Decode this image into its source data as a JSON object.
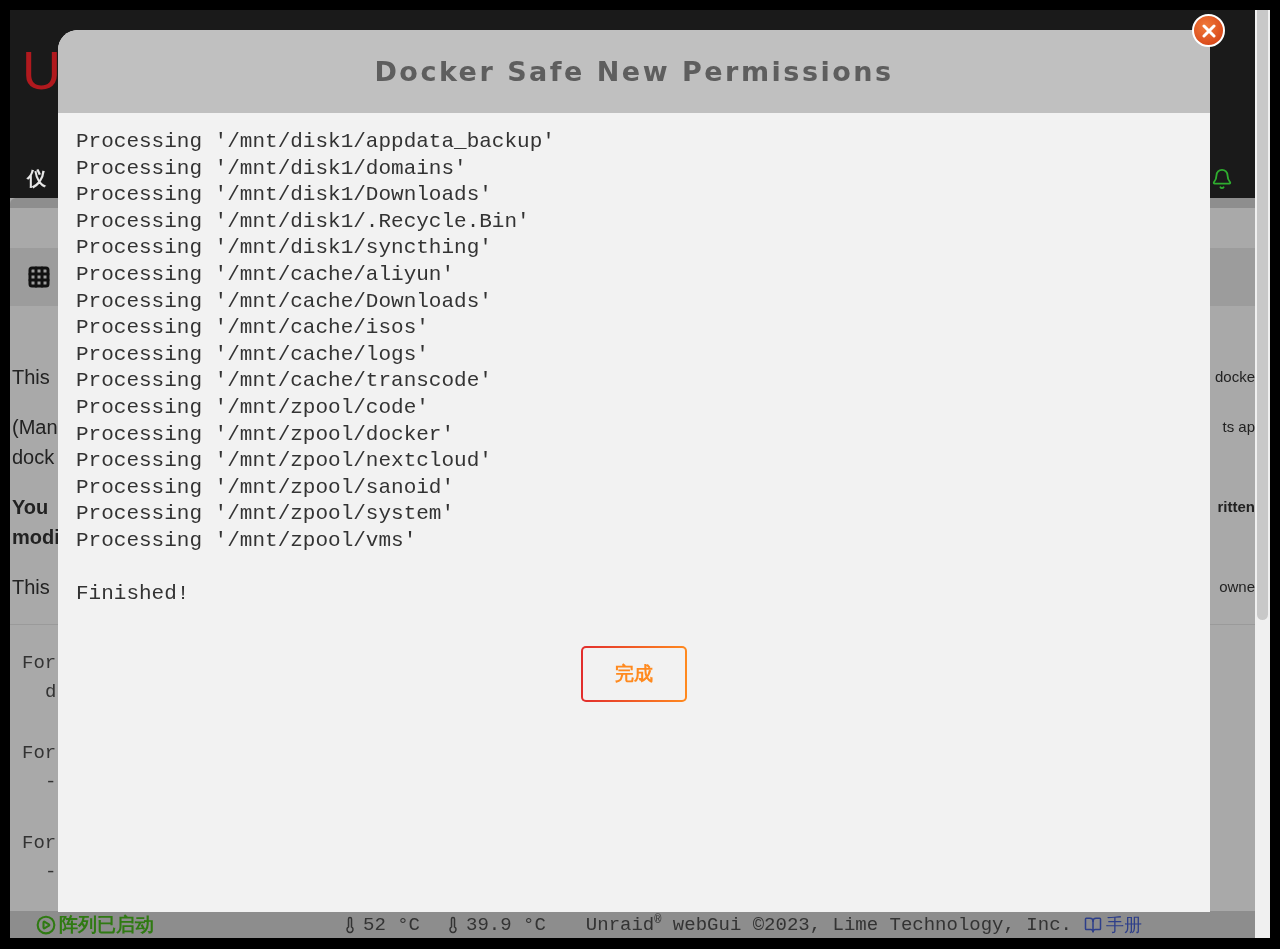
{
  "background_page": {
    "logo": "U",
    "nav_item": "仪",
    "paragraphs": [
      {
        "bold": false,
        "lines": [
          {
            "left": "This",
            "right": "docke"
          }
        ]
      },
      {
        "bold": false,
        "lines": [
          {
            "left": "(Man",
            "right": "ts ap"
          },
          {
            "left": "dock"
          }
        ]
      },
      {
        "bold": true,
        "lines": [
          {
            "left": "You",
            "right": "ritten"
          },
          {
            "left": "modi"
          }
        ]
      },
      {
        "bold": false,
        "lines": [
          {
            "left": "This",
            "right": "owne"
          }
        ]
      }
    ],
    "code_lines": [
      {
        "kind": "start",
        "text": "For"
      },
      {
        "kind": "cont",
        "text": "d"
      },
      {
        "kind": "start",
        "text": "For"
      },
      {
        "kind": "cont",
        "text": "-"
      },
      {
        "kind": "start",
        "text": "For"
      },
      {
        "kind": "cont",
        "text": "-"
      }
    ]
  },
  "dialog": {
    "title": "Docker Safe New Permissions",
    "lines": [
      "Processing '/mnt/disk1/appdata_backup'",
      "Processing '/mnt/disk1/domains'",
      "Processing '/mnt/disk1/Downloads'",
      "Processing '/mnt/disk1/.Recycle.Bin'",
      "Processing '/mnt/disk1/syncthing'",
      "Processing '/mnt/cache/aliyun'",
      "Processing '/mnt/cache/Downloads'",
      "Processing '/mnt/cache/isos'",
      "Processing '/mnt/cache/logs'",
      "Processing '/mnt/cache/transcode'",
      "Processing '/mnt/zpool/code'",
      "Processing '/mnt/zpool/docker'",
      "Processing '/mnt/zpool/nextcloud'",
      "Processing '/mnt/zpool/sanoid'",
      "Processing '/mnt/zpool/system'",
      "Processing '/mnt/zpool/vms'"
    ],
    "result": "Finished!",
    "button": "完成"
  },
  "status_bar": {
    "array_status": "阵列已启动",
    "temperatures": [
      "52 °C",
      "39.9 °C"
    ],
    "copyright": "Unraid$^{®}$ webGui ©2023, Lime Technology, Inc.",
    "manual": "手册"
  }
}
